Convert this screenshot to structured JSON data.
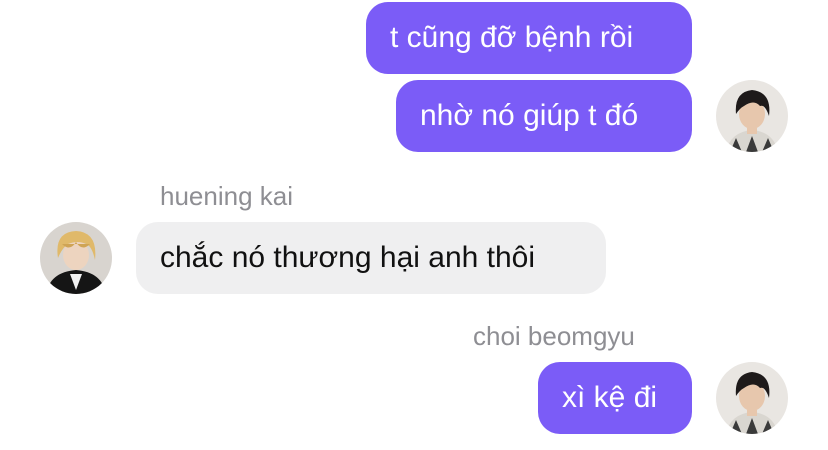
{
  "colors": {
    "sent_bubble": "#7b5cf7",
    "received_bubble": "#efeff0",
    "sender_name": "#8e8e93"
  },
  "messages": [
    {
      "direction": "sent",
      "text": "t cũng đỡ bệnh rồi"
    },
    {
      "direction": "sent",
      "text": "nhờ nó giúp t đó",
      "avatar": "beomgyu-avatar"
    },
    {
      "direction": "received",
      "sender": "huening kai",
      "text": "chắc nó thương hại anh thôi",
      "avatar": "huening-kai-avatar"
    },
    {
      "direction": "sent",
      "sender": "choi beomgyu",
      "text": "xì kệ đi",
      "avatar": "beomgyu-avatar"
    }
  ]
}
